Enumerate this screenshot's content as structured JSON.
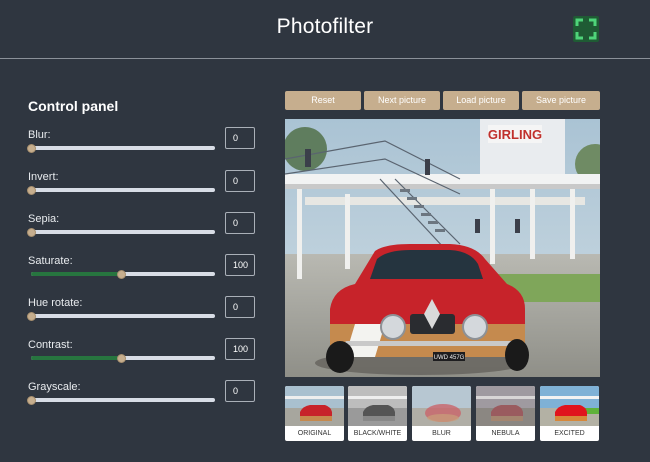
{
  "header": {
    "title": "Photofilter",
    "fullscreen_icon": "fullscreen-icon"
  },
  "control_panel": {
    "title": "Control panel",
    "controls": [
      {
        "label": "Blur:",
        "value": "0",
        "level": 0
      },
      {
        "label": "Invert:",
        "value": "0",
        "level": 0
      },
      {
        "label": "Sepia:",
        "value": "0",
        "level": 0
      },
      {
        "label": "Saturate:",
        "value": "100",
        "level": 0.5
      },
      {
        "label": "Hue rotate:",
        "value": "0",
        "level": 0
      },
      {
        "label": "Contrast:",
        "value": "100",
        "level": 0.5
      },
      {
        "label": "Grayscale:",
        "value": "0",
        "level": 0
      }
    ]
  },
  "toolbar": {
    "reset": "Reset",
    "next": "Next picture",
    "load": "Load picture",
    "save": "Save picture"
  },
  "presets": [
    "ORIGINAL",
    "BLACK/WHITE",
    "BLUR",
    "NEBULA",
    "EXCITED"
  ],
  "photo_text": {
    "sign": "GIRLING",
    "plate": "UWD 457G"
  },
  "colors": {
    "background": "#2f3640",
    "accent": "#c6ae8e",
    "slider_fill": "#27753f",
    "fullscreen_bg": "#1f5b34"
  }
}
